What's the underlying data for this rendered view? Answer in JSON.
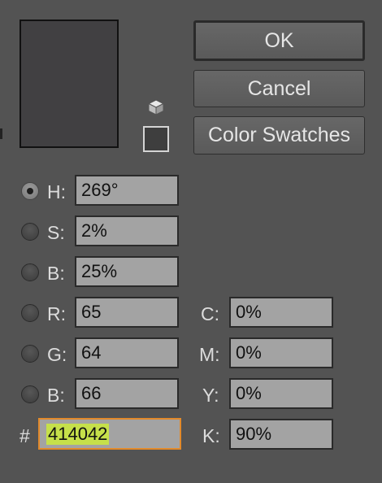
{
  "preview": {
    "color": "#414042"
  },
  "buttons": {
    "ok": "OK",
    "cancel": "Cancel",
    "swatches": "Color Swatches"
  },
  "hsb": [
    {
      "label": "H:",
      "value": "269°",
      "checked": true
    },
    {
      "label": "S:",
      "value": "2%",
      "checked": false
    },
    {
      "label": "B:",
      "value": "25%",
      "checked": false
    }
  ],
  "rgb": [
    {
      "label": "R:",
      "value": "65",
      "checked": false
    },
    {
      "label": "G:",
      "value": "64",
      "checked": false
    },
    {
      "label": "B:",
      "value": "66",
      "checked": false
    }
  ],
  "cmyk": [
    {
      "label": "C:",
      "value": "0%"
    },
    {
      "label": "M:",
      "value": "0%"
    },
    {
      "label": "Y:",
      "value": "0%"
    },
    {
      "label": "K:",
      "value": "90%"
    }
  ],
  "hex": {
    "label": "#",
    "value": "414042"
  },
  "colors": {
    "highlight": "#c6e04a",
    "focus_border": "#e28a2b"
  }
}
